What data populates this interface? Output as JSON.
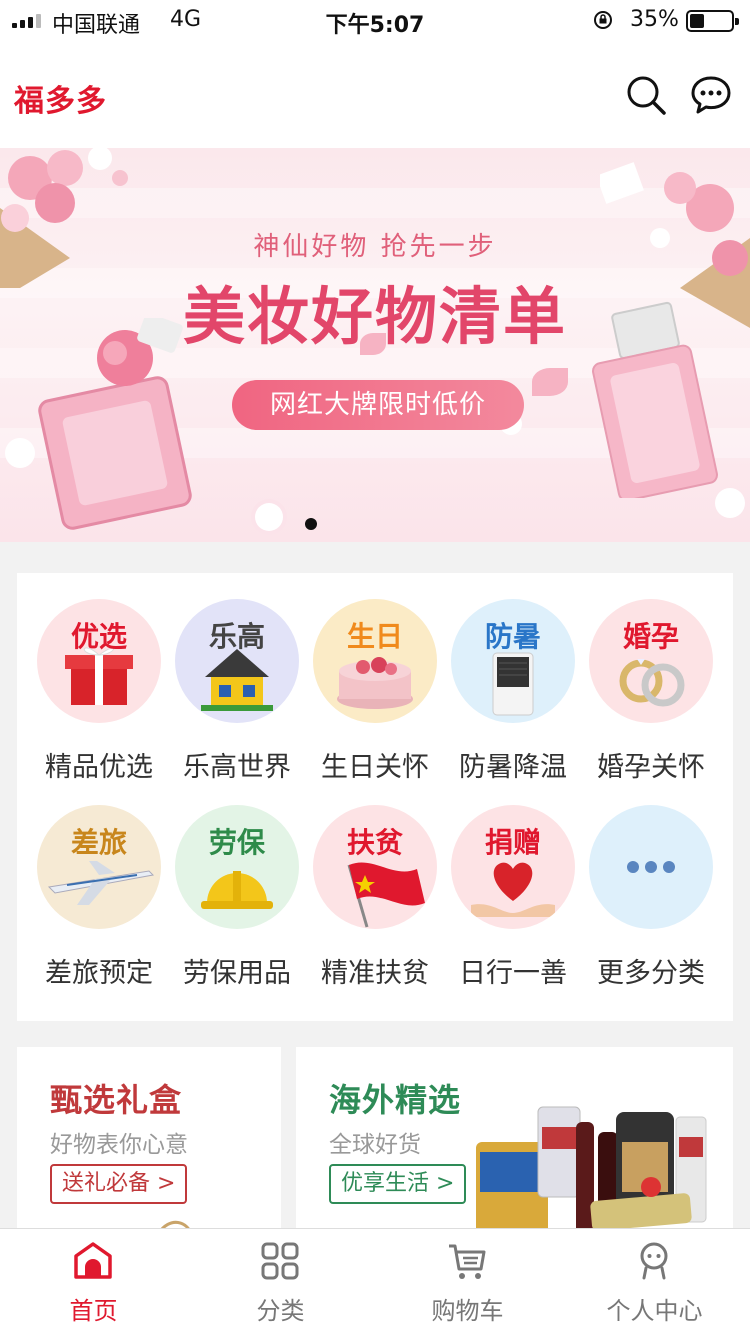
{
  "status_bar": {
    "carrier": "中国联通",
    "network": "4G",
    "time": "下午5:07",
    "battery": "35%",
    "battery_level": 0.35
  },
  "header": {
    "title": "福多多",
    "search_icon": "search-icon",
    "message_icon": "chat-bubble-icon"
  },
  "banner": {
    "subtitle": "神仙好物 抢先一步",
    "title": "美妆好物清单",
    "button": "网红大牌限时低价",
    "page_index": 1
  },
  "categories": [
    {
      "tag": "优选",
      "label": "精品优选",
      "tag_color": "#e0182e",
      "bg": "#fde3e5",
      "icon": "gift-box-icon"
    },
    {
      "tag": "乐高",
      "label": "乐高世界",
      "tag_color": "#444444",
      "bg": "#e2e3f8",
      "icon": "lego-house-icon"
    },
    {
      "tag": "生日",
      "label": "生日关怀",
      "tag_color": "#f08a1c",
      "bg": "#fbebc6",
      "icon": "birthday-cake-icon"
    },
    {
      "tag": "防暑",
      "label": "防暑降温",
      "tag_color": "#2a76c8",
      "bg": "#def0fb",
      "icon": "air-cooler-icon"
    },
    {
      "tag": "婚孕",
      "label": "婚孕关怀",
      "tag_color": "#e0182e",
      "bg": "#fde3e5",
      "icon": "wedding-rings-icon"
    },
    {
      "tag": "差旅",
      "label": "差旅预定",
      "tag_color": "#c8861c",
      "bg": "#f6ead4",
      "icon": "airplane-icon"
    },
    {
      "tag": "劳保",
      "label": "劳保用品",
      "tag_color": "#2e8b4a",
      "bg": "#e3f4e6",
      "icon": "safety-helmet-icon"
    },
    {
      "tag": "扶贫",
      "label": "精准扶贫",
      "tag_color": "#e0182e",
      "bg": "#fde3e5",
      "icon": "red-flag-icon"
    },
    {
      "tag": "捐赠",
      "label": "日行一善",
      "tag_color": "#e0182e",
      "bg": "#fde3e5",
      "icon": "heart-in-hands-icon"
    },
    {
      "tag": "",
      "label": "更多分类",
      "tag_color": "#5a86c0",
      "bg": "#def0fb",
      "icon": "more-dots-icon"
    }
  ],
  "promos": {
    "left": {
      "title": "甄选礼盒",
      "subtitle": "好物表你心意",
      "button": "送礼必备 >",
      "color": "#c0393b"
    },
    "right": {
      "title": "海外精选",
      "subtitle": "全球好货",
      "button": "优享生活 >",
      "color": "#2e8b57"
    }
  },
  "tabbar": {
    "items": [
      {
        "label": "首页",
        "icon": "home-icon",
        "active": true
      },
      {
        "label": "分类",
        "icon": "grid-icon",
        "active": false
      },
      {
        "label": "购物车",
        "icon": "cart-icon",
        "active": false
      },
      {
        "label": "个人中心",
        "icon": "user-icon",
        "active": false
      }
    ],
    "active_color": "#e0182e"
  }
}
